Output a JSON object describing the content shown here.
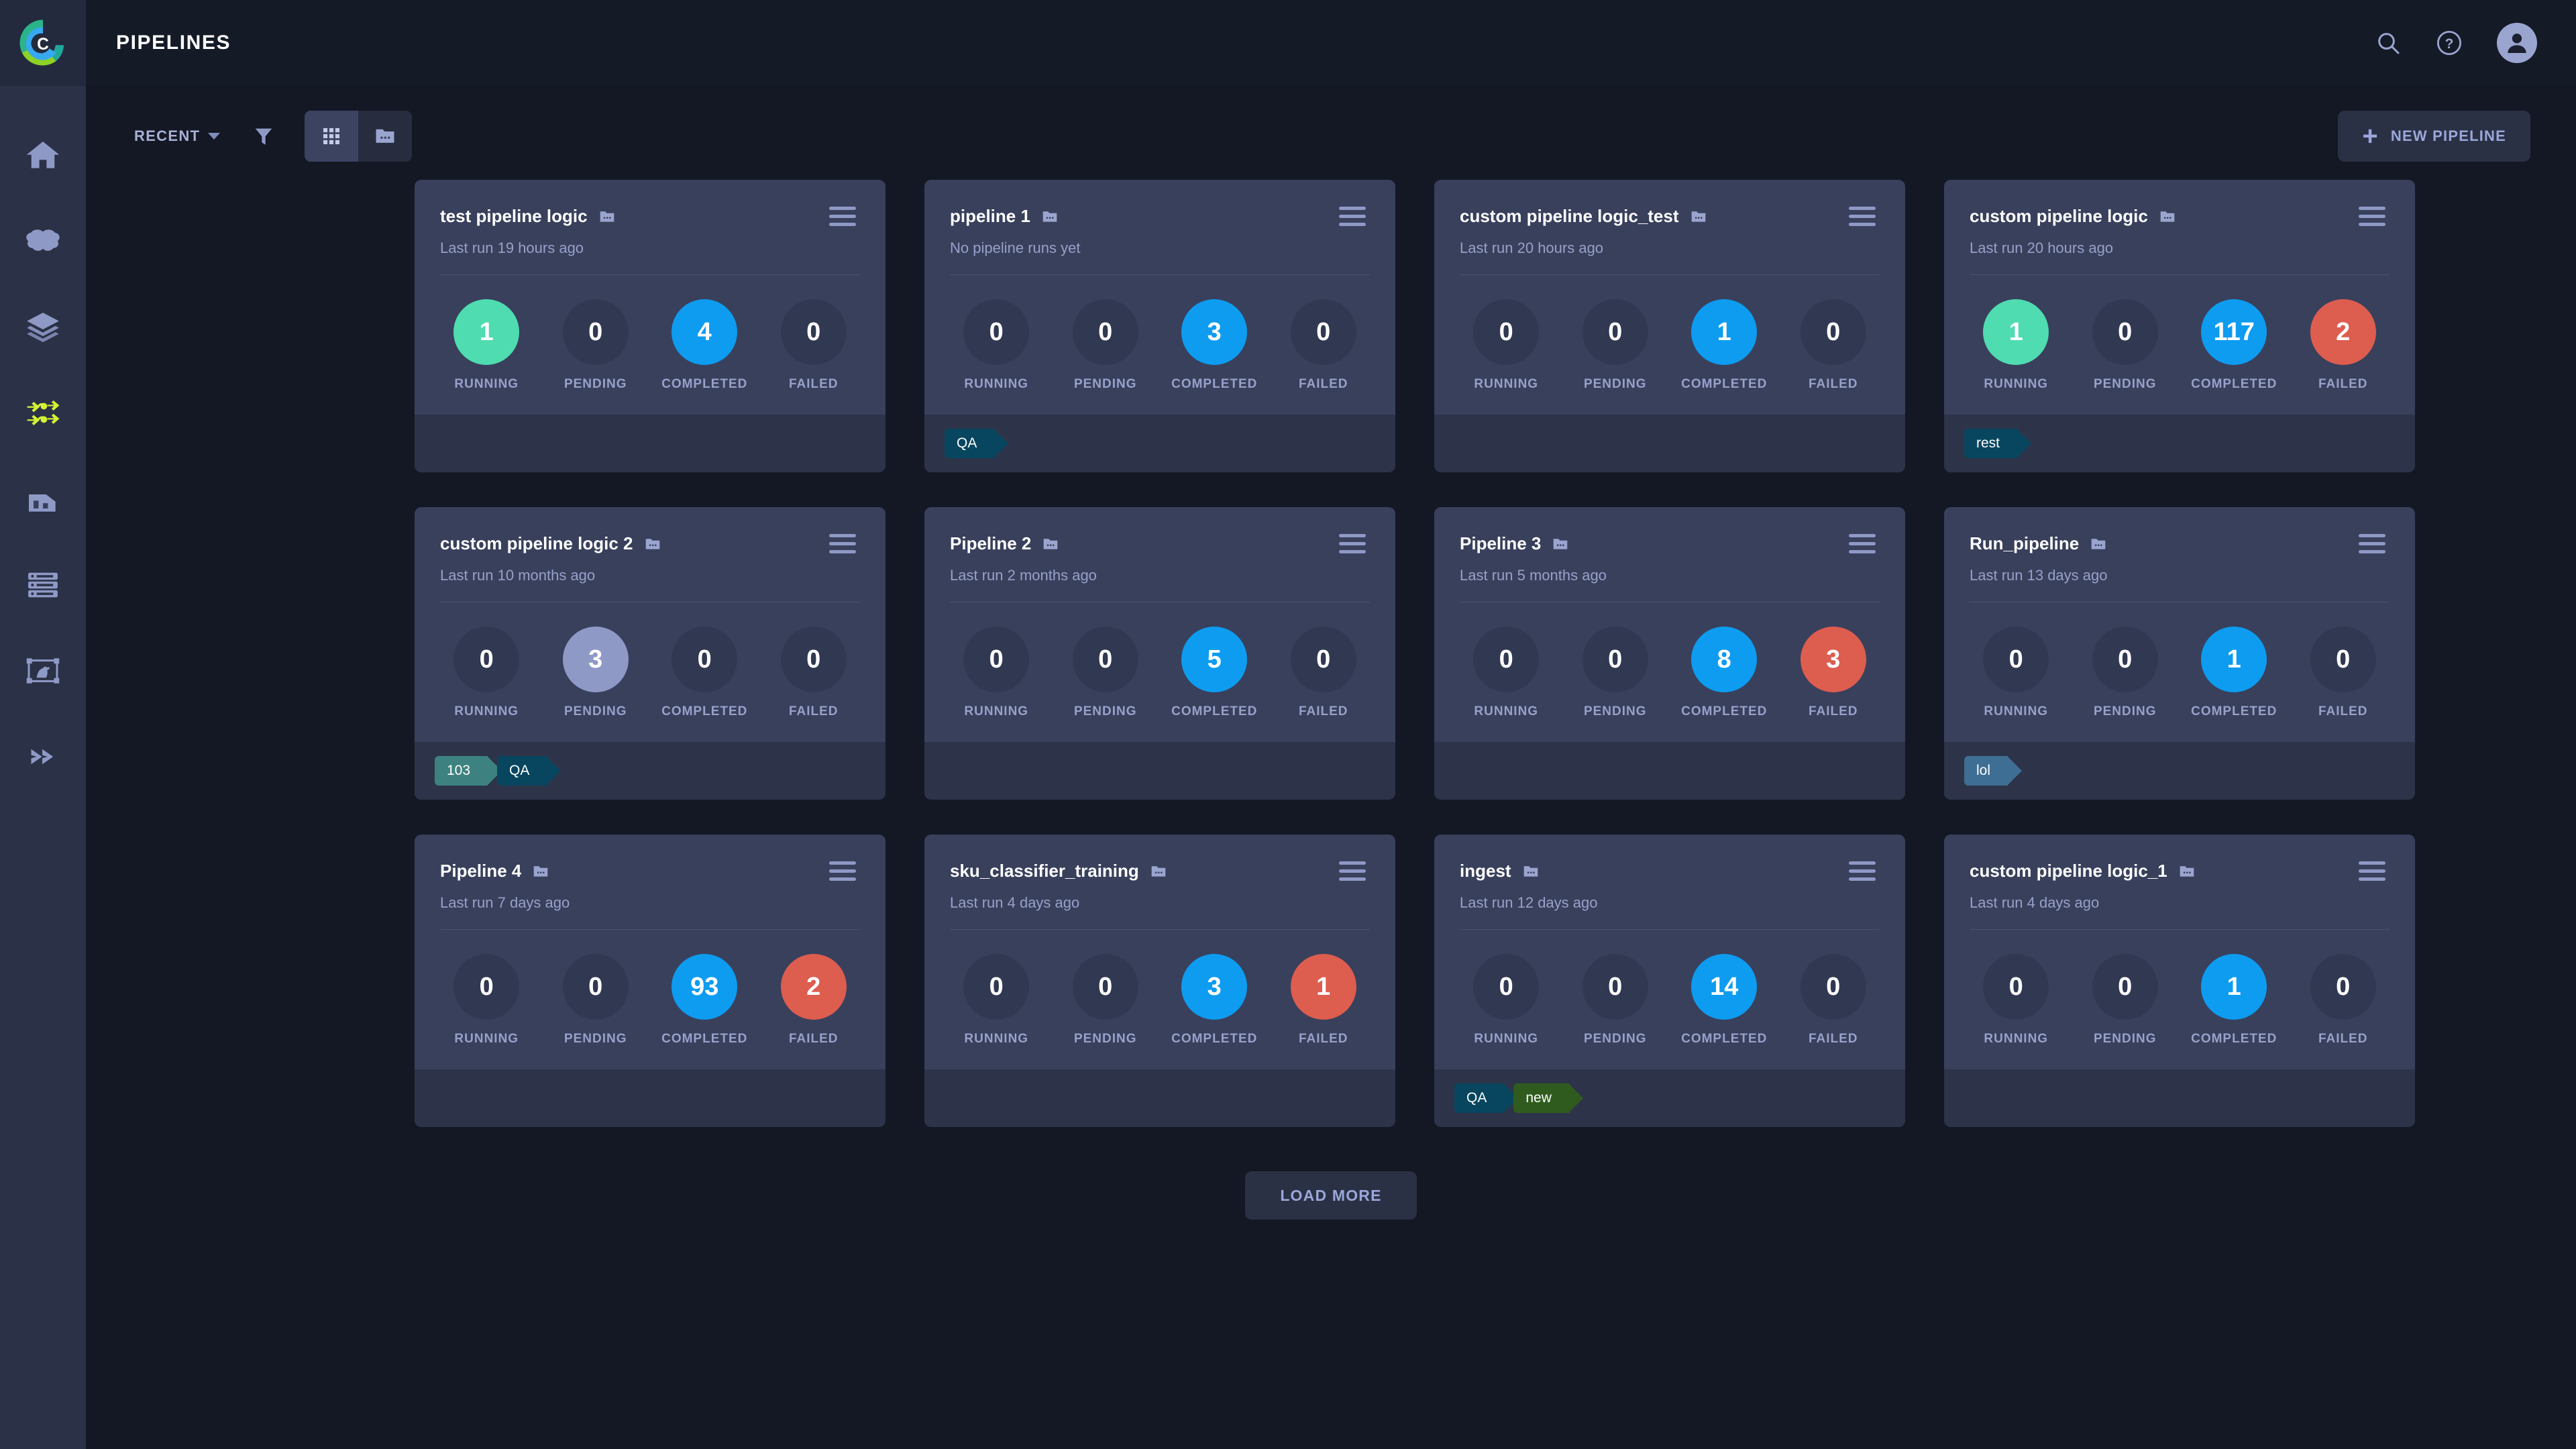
{
  "header": {
    "title": "PIPELINES",
    "logo_icon": "cogniac-c-logo",
    "search_icon": "search-icon",
    "help_icon": "help-circle-icon",
    "avatar_icon": "user-avatar-icon"
  },
  "sidebar": {
    "items": [
      {
        "name": "home",
        "icon": "home-icon",
        "active": false
      },
      {
        "name": "models",
        "icon": "brain-icon",
        "active": false
      },
      {
        "name": "layers",
        "icon": "layers-icon",
        "active": false
      },
      {
        "name": "pipelines",
        "icon": "pipelines-icon",
        "active": true
      },
      {
        "name": "reports",
        "icon": "chart-building-icon",
        "active": false
      },
      {
        "name": "datasets",
        "icon": "server-rack-icon",
        "active": false
      },
      {
        "name": "annotations",
        "icon": "image-annotate-icon",
        "active": false
      },
      {
        "name": "deploy",
        "icon": "double-chevron-right-icon",
        "active": false
      }
    ]
  },
  "toolbar": {
    "sort_label": "RECENT",
    "sort_caret_icon": "chevron-down-icon",
    "filter_icon": "funnel-filter-icon",
    "grid_view_icon": "grid-view-icon",
    "folder_view_icon": "folder-view-icon",
    "active_view": "grid",
    "new_pipeline_label": "NEW PIPELINE",
    "new_pipeline_icon": "plus-icon"
  },
  "stat_labels": [
    "RUNNING",
    "PENDING",
    "COMPLETED",
    "FAILED"
  ],
  "colors": {
    "running": "#4edcb0",
    "pending": "#8e99c6",
    "completed": "#0d9cf0",
    "failed": "#dd5d4f",
    "bubble_empty": "#313852",
    "card_bg": "#39405c",
    "card_footer_bg": "#2d3449",
    "page_bg": "#141824",
    "sidebar_bg": "#2b3146",
    "topbar_bg": "#151a27",
    "accent_text": "#9aa7da"
  },
  "tag_colors": {
    "QA": "#08465f",
    "rest": "#08465f",
    "103": "#3d8280",
    "lol": "#3e6e94",
    "new": "#2f5c1e"
  },
  "cards": [
    {
      "title": "test pipeline logic",
      "folder_icon": "folder-dots-icon",
      "menu_icon": "hamburger-menu-icon",
      "subtitle": "Last run 19 hours ago",
      "stats": {
        "running": "1",
        "pending": "0",
        "completed": "4",
        "failed": "0"
      },
      "tags": []
    },
    {
      "title": "pipeline 1",
      "folder_icon": "folder-dots-icon",
      "menu_icon": "hamburger-menu-icon",
      "subtitle": "No pipeline runs yet",
      "stats": {
        "running": "0",
        "pending": "0",
        "completed": "3",
        "failed": "0"
      },
      "tags": [
        "QA"
      ]
    },
    {
      "title": "custom pipeline logic_test",
      "folder_icon": "folder-dots-icon",
      "menu_icon": "hamburger-menu-icon",
      "subtitle": "Last run 20 hours ago",
      "stats": {
        "running": "0",
        "pending": "0",
        "completed": "1",
        "failed": "0"
      },
      "tags": []
    },
    {
      "title": "custom pipeline logic",
      "folder_icon": "folder-dots-icon",
      "menu_icon": "hamburger-menu-icon",
      "subtitle": "Last run 20 hours ago",
      "stats": {
        "running": "1",
        "pending": "0",
        "completed": "117",
        "failed": "2"
      },
      "tags": [
        "rest"
      ]
    },
    {
      "title": "custom pipeline logic 2",
      "folder_icon": "folder-dots-icon",
      "menu_icon": "hamburger-menu-icon",
      "subtitle": "Last run 10 months ago",
      "stats": {
        "running": "0",
        "pending": "3",
        "completed": "0",
        "failed": "0"
      },
      "tags": [
        "103",
        "QA"
      ]
    },
    {
      "title": "Pipeline 2",
      "folder_icon": "folder-dots-icon",
      "menu_icon": "hamburger-menu-icon",
      "subtitle": "Last run 2 months ago",
      "stats": {
        "running": "0",
        "pending": "0",
        "completed": "5",
        "failed": "0"
      },
      "tags": []
    },
    {
      "title": "Pipeline 3",
      "folder_icon": "folder-dots-icon",
      "menu_icon": "hamburger-menu-icon",
      "subtitle": "Last run 5 months ago",
      "stats": {
        "running": "0",
        "pending": "0",
        "completed": "8",
        "failed": "3"
      },
      "tags": []
    },
    {
      "title": "Run_pipeline",
      "folder_icon": "folder-dots-icon",
      "menu_icon": "hamburger-menu-icon",
      "subtitle": "Last run 13 days ago",
      "stats": {
        "running": "0",
        "pending": "0",
        "completed": "1",
        "failed": "0"
      },
      "tags": [
        "lol"
      ]
    },
    {
      "title": "Pipeline 4",
      "folder_icon": "folder-dots-icon",
      "menu_icon": "hamburger-menu-icon",
      "subtitle": "Last run 7 days ago",
      "stats": {
        "running": "0",
        "pending": "0",
        "completed": "93",
        "failed": "2"
      },
      "tags": []
    },
    {
      "title": "sku_classifier_training",
      "folder_icon": "folder-dots-icon",
      "menu_icon": "hamburger-menu-icon",
      "subtitle": "Last run 4 days ago",
      "stats": {
        "running": "0",
        "pending": "0",
        "completed": "3",
        "failed": "1"
      },
      "tags": []
    },
    {
      "title": "ingest",
      "folder_icon": "folder-dots-icon",
      "menu_icon": "hamburger-menu-icon",
      "subtitle": "Last run 12 days ago",
      "stats": {
        "running": "0",
        "pending": "0",
        "completed": "14",
        "failed": "0"
      },
      "tags": [
        "QA",
        "new"
      ]
    },
    {
      "title": "custom pipeline logic_1",
      "folder_icon": "folder-dots-icon",
      "menu_icon": "hamburger-menu-icon",
      "subtitle": "Last run 4 days ago",
      "stats": {
        "running": "0",
        "pending": "0",
        "completed": "1",
        "failed": "0"
      },
      "tags": []
    }
  ],
  "footer": {
    "load_more_label": "LOAD MORE"
  }
}
